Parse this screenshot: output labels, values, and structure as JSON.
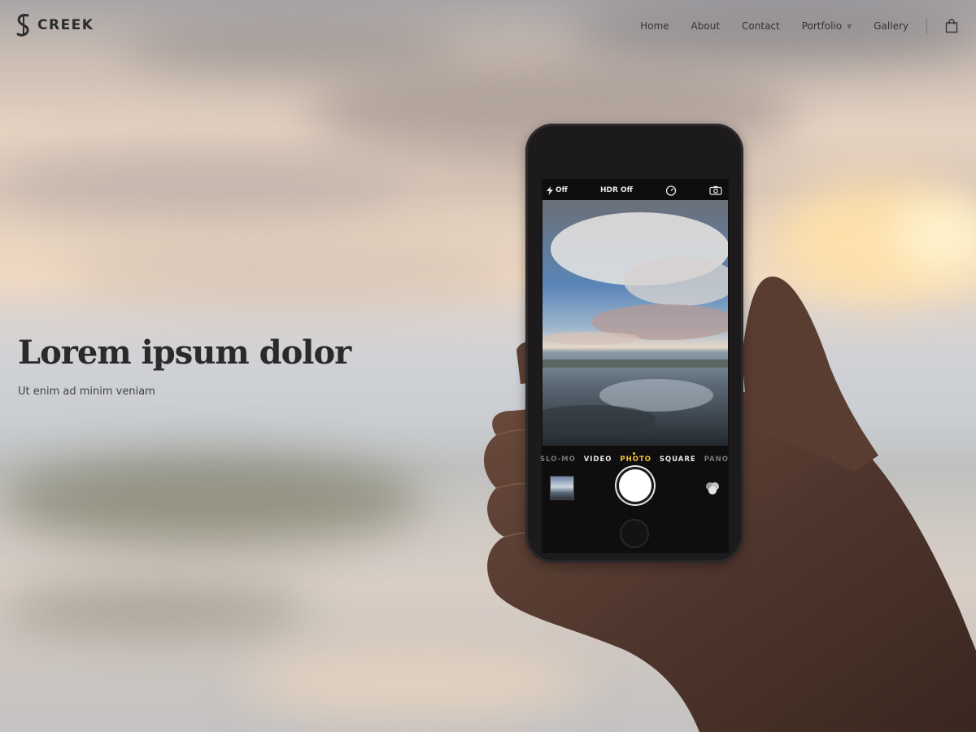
{
  "header": {
    "logo_text": "CREEK",
    "nav": [
      {
        "label": "Home"
      },
      {
        "label": "About"
      },
      {
        "label": "Contact"
      },
      {
        "label": "Portfolio",
        "has_dropdown": true
      },
      {
        "label": "Gallery"
      }
    ],
    "cart_icon": "shopping-bag-icon"
  },
  "hero": {
    "title": "Lorem ipsum dolor",
    "subtitle": "Ut enim ad minim veniam"
  },
  "phone": {
    "flash_label": "Off",
    "hdr_label": "HDR Off",
    "modes": [
      "SLO-MO",
      "VIDEO",
      "PHOTO",
      "SQUARE",
      "PANO"
    ],
    "active_mode": "PHOTO"
  },
  "colors": {
    "text_dark": "#2a2a2a",
    "active_mode": "#f2c233"
  }
}
